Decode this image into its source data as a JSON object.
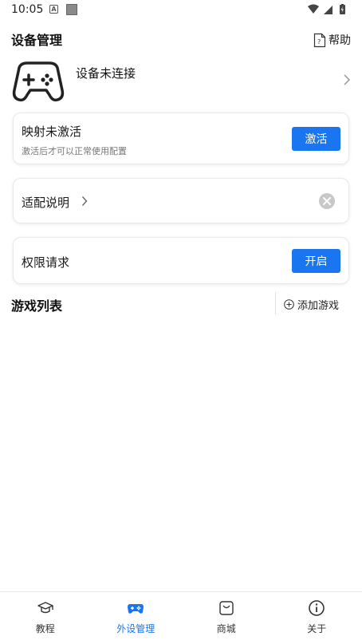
{
  "status_bar": {
    "time": "10:05",
    "a_glyph": "A"
  },
  "header": {
    "title": "设备管理",
    "help_label": "帮助",
    "help_icon": "help-document-icon"
  },
  "device": {
    "status": "设备未连接",
    "icon": "gamepad-icon"
  },
  "activation_card": {
    "title": "映射未激活",
    "subtitle": "激活后才可以正常使用配置",
    "button_label": "激活"
  },
  "adapt_card": {
    "title": "适配说明"
  },
  "permission_card": {
    "title": "权限请求",
    "button_label": "开启"
  },
  "games": {
    "title": "游戏列表",
    "add_label": "添加游戏"
  },
  "bottom_nav": {
    "items": [
      {
        "label": "教程",
        "icon": "graduation-cap-icon",
        "active": false
      },
      {
        "label": "外设管理",
        "icon": "gamepad-icon",
        "active": true
      },
      {
        "label": "商城",
        "icon": "shopping-bag-icon",
        "active": false
      },
      {
        "label": "关于",
        "icon": "info-icon",
        "active": false
      }
    ]
  },
  "colors": {
    "accent": "#1976f0",
    "text": "#1a1a1a",
    "muted": "#777777"
  }
}
